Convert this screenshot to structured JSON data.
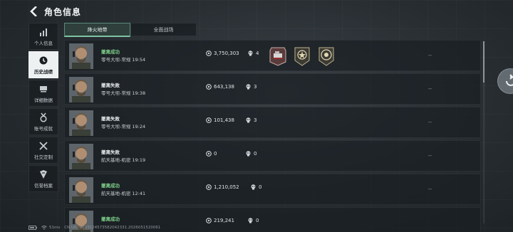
{
  "header": {
    "title": "角色信息"
  },
  "sidebar": {
    "items": [
      {
        "label": "个人信息",
        "icon": "bar-chart-icon"
      },
      {
        "label": "历史战绩",
        "icon": "clock-icon"
      },
      {
        "label": "详细数据",
        "icon": "data-cards-icon"
      },
      {
        "label": "账号成就",
        "icon": "medal-icon"
      },
      {
        "label": "社交定制",
        "icon": "tools-icon"
      },
      {
        "label": "信誉档案",
        "icon": "trust-shield-icon"
      }
    ]
  },
  "tabs": [
    {
      "label": "烽火地带"
    },
    {
      "label": "全面战场"
    }
  ],
  "records": [
    {
      "status": "撤离成功",
      "map_time": "零号大坝-常规 19:54",
      "coins": "3,750,303",
      "kills": "4",
      "result": "--"
    },
    {
      "status": "撤离失败",
      "map_time": "零号大坝-常规 19:38",
      "coins": "643,138",
      "kills": "3",
      "result": "--"
    },
    {
      "status": "撤离失败",
      "map_time": "零号大坝-常规 19:24",
      "coins": "101,438",
      "kills": "3",
      "result": "--"
    },
    {
      "status": "撤离失败",
      "map_time": "航天基地-机密 19:19",
      "coins": "0",
      "kills": "0",
      "result": "--"
    },
    {
      "status": "撤离成功",
      "map_time": "航天基地-机密 12:41",
      "coins": "1,210,052",
      "kills": "0",
      "result": "--"
    },
    {
      "status": "撤离成功",
      "map_time": "",
      "coins": "219,241",
      "kills": "0",
      "result": ""
    }
  ],
  "footer": {
    "ping": "51ms",
    "uid": "CN UID:9033124573582042331.2026051520061"
  },
  "colors": {
    "success": "#7fd08a",
    "tab_accent": "#7fc3a4"
  }
}
